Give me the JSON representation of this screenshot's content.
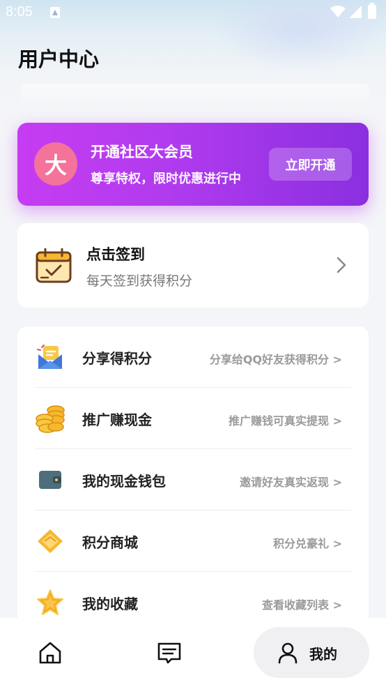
{
  "status_bar": {
    "time": "8:05"
  },
  "header": {
    "title": "用户中心"
  },
  "vip": {
    "avatar_text": "大",
    "title": "开通社区大会员",
    "subtitle": "尊享特权，限时优惠进行中",
    "button_label": "立即开通"
  },
  "checkin": {
    "title": "点击签到",
    "subtitle": "每天签到获得积分"
  },
  "menu": {
    "items": [
      {
        "label": "分享得积分",
        "hint": "分享给QQ好友获得积分 >",
        "icon": "share-envelope-icon"
      },
      {
        "label": "推广赚现金",
        "hint": "推广赚钱可真实提现 >",
        "icon": "gold-coins-icon"
      },
      {
        "label": "我的现金钱包",
        "hint": "邀请好友真实返现 >",
        "icon": "wallet-icon"
      },
      {
        "label": "积分商城",
        "hint": "积分兑豪礼 >",
        "icon": "diamond-icon"
      },
      {
        "label": "我的收藏",
        "hint": "查看收藏列表 >",
        "icon": "star-icon"
      }
    ]
  },
  "bottom_nav": {
    "items": [
      {
        "icon": "home-icon"
      },
      {
        "icon": "message-icon"
      },
      {
        "icon": "user-icon",
        "label": "我的",
        "active": true
      }
    ]
  },
  "colors": {
    "vip_gradient_start": "#c63cf2",
    "vip_gradient_end": "#8a2fe0",
    "avatar_pink": "#f3739b",
    "page_bg": "#f4f5f8"
  }
}
